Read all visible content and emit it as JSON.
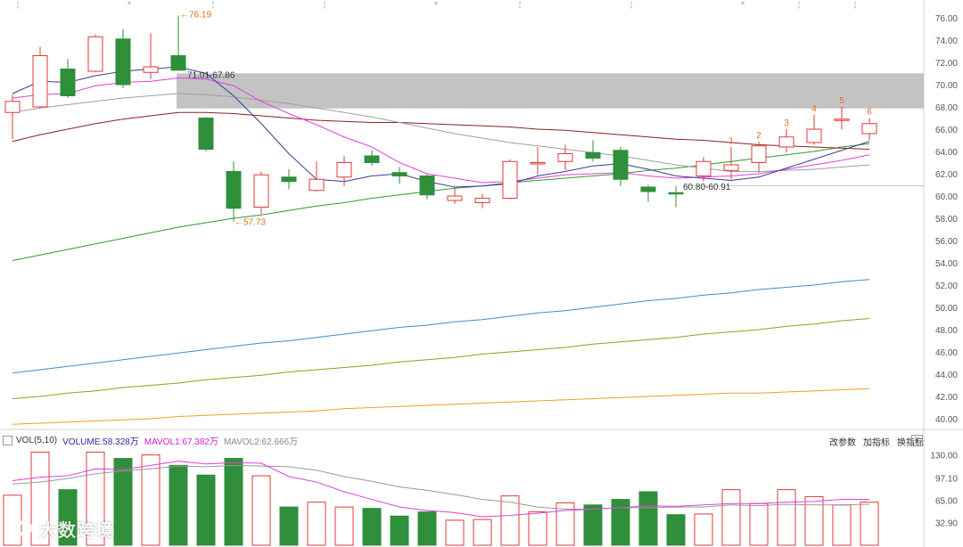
{
  "colors": {
    "up": "#e03a3a",
    "down": "#2f8f3a",
    "ma5": "#3b3b8f",
    "ma10": "#e040e0",
    "ma20": "#a0a0a0",
    "ma60": "#8b2020",
    "ma120": "#2e9c2e",
    "ma250a": "#3a8fd0",
    "ma250b": "#9a9a20",
    "ma250c": "#f0a020",
    "zone": "#b8b8b8",
    "annot": "#e07020",
    "dark_text": "#333333"
  },
  "chart_data": [
    {
      "type": "candlestick",
      "y_ticks": [
        "76.00",
        "74.00",
        "72.00",
        "70.00",
        "68.00",
        "66.00",
        "64.00",
        "62.00",
        "60.00",
        "58.00",
        "56.00",
        "54.00",
        "52.00",
        "50.00",
        "48.00",
        "46.00",
        "44.00",
        "42.00",
        "40.00"
      ],
      "ylim": [
        39.5,
        76.5
      ],
      "candles": [
        {
          "o": 67.5,
          "h": 69.1,
          "l": 65.1,
          "c": 68.5
        },
        {
          "o": 68.0,
          "h": 73.4,
          "l": 67.9,
          "c": 72.6
        },
        {
          "o": 71.4,
          "h": 72.3,
          "l": 68.8,
          "c": 69.0
        },
        {
          "o": 71.2,
          "h": 74.5,
          "l": 71.1,
          "c": 74.3
        },
        {
          "o": 74.1,
          "h": 75.0,
          "l": 69.7,
          "c": 70.0
        },
        {
          "o": 71.1,
          "h": 74.6,
          "l": 70.5,
          "c": 71.6
        },
        {
          "o": 72.6,
          "h": 76.2,
          "l": 71.3,
          "c": 71.3
        },
        {
          "o": 67.0,
          "h": 67.1,
          "l": 64.0,
          "c": 64.2
        },
        {
          "o": 62.2,
          "h": 63.1,
          "l": 57.7,
          "c": 58.9
        },
        {
          "o": 59.0,
          "h": 62.2,
          "l": 58.4,
          "c": 61.9
        },
        {
          "o": 61.7,
          "h": 62.4,
          "l": 60.6,
          "c": 61.3
        },
        {
          "o": 60.5,
          "h": 63.1,
          "l": 60.4,
          "c": 61.5
        },
        {
          "o": 61.7,
          "h": 63.6,
          "l": 60.9,
          "c": 63.0
        },
        {
          "o": 63.6,
          "h": 64.1,
          "l": 62.7,
          "c": 63.0
        },
        {
          "o": 62.1,
          "h": 62.6,
          "l": 61.1,
          "c": 61.8
        },
        {
          "o": 61.8,
          "h": 62.0,
          "l": 59.7,
          "c": 60.1
        },
        {
          "o": 59.6,
          "h": 60.7,
          "l": 59.3,
          "c": 60.0
        },
        {
          "o": 59.4,
          "h": 60.2,
          "l": 58.9,
          "c": 59.8
        },
        {
          "o": 59.8,
          "h": 63.3,
          "l": 59.7,
          "c": 63.1
        },
        {
          "o": 63.0,
          "h": 64.4,
          "l": 61.9,
          "c": 63.0
        },
        {
          "o": 63.1,
          "h": 64.6,
          "l": 62.3,
          "c": 63.8
        },
        {
          "o": 63.9,
          "h": 65.0,
          "l": 63.1,
          "c": 63.4
        },
        {
          "o": 64.1,
          "h": 64.4,
          "l": 60.9,
          "c": 61.5
        },
        {
          "o": 60.8,
          "h": 61.0,
          "l": 59.5,
          "c": 60.4
        },
        {
          "o": 60.3,
          "h": 60.9,
          "l": 59.0,
          "c": 60.2
        },
        {
          "o": 61.8,
          "h": 63.5,
          "l": 61.3,
          "c": 63.1
        },
        {
          "o": 62.3,
          "h": 64.4,
          "l": 61.5,
          "c": 62.8
        },
        {
          "o": 63.0,
          "h": 64.9,
          "l": 62.1,
          "c": 64.5
        },
        {
          "o": 64.4,
          "h": 66.0,
          "l": 63.9,
          "c": 65.3
        },
        {
          "o": 64.8,
          "h": 67.3,
          "l": 64.6,
          "c": 66.0
        },
        {
          "o": 66.9,
          "h": 68.0,
          "l": 66.0,
          "c": 66.9
        },
        {
          "o": 65.6,
          "h": 67.0,
          "l": 65.0,
          "c": 66.5
        }
      ],
      "ma5": [
        69.2,
        70.3,
        70.2,
        70.8,
        71.2,
        71.4,
        71.6,
        71.0,
        69.0,
        66.5,
        63.8,
        61.5,
        61.3,
        61.8,
        62.0,
        61.3,
        60.8,
        60.9,
        61.1,
        61.8,
        62.2,
        62.7,
        62.9,
        62.4,
        61.8,
        61.6,
        61.4,
        61.7,
        62.5,
        63.3,
        64.1,
        64.9
      ],
      "ma10": [
        68.8,
        69.1,
        69.2,
        69.9,
        70.2,
        70.3,
        70.6,
        70.5,
        69.9,
        68.5,
        67.4,
        66.4,
        65.3,
        64.4,
        63.0,
        62.0,
        61.6,
        61.2,
        61.3,
        61.6,
        61.9,
        62.0,
        62.1,
        61.8,
        61.6,
        61.7,
        61.8,
        62.0,
        62.4,
        62.8,
        63.2,
        63.7
      ],
      "ma20": [
        67.5,
        67.9,
        68.2,
        68.5,
        68.8,
        69.0,
        69.2,
        69.1,
        68.9,
        68.6,
        68.3,
        67.9,
        67.5,
        67.1,
        66.6,
        66.1,
        65.6,
        65.2,
        64.8,
        64.5,
        64.2,
        63.9,
        63.6,
        63.2,
        62.8,
        62.5,
        62.2,
        62.2,
        62.3,
        62.4,
        62.6,
        62.8
      ],
      "ma60": [
        64.9,
        65.5,
        66.0,
        66.5,
        66.9,
        67.2,
        67.5,
        67.5,
        67.4,
        67.2,
        67.0,
        66.8,
        66.7,
        66.6,
        66.6,
        66.5,
        66.4,
        66.3,
        66.2,
        66.0,
        65.9,
        65.7,
        65.5,
        65.3,
        65.1,
        65.0,
        64.8,
        64.6,
        64.5,
        64.4,
        64.3,
        64.2
      ],
      "ma120": [
        54.2,
        54.7,
        55.2,
        55.7,
        56.2,
        56.7,
        57.2,
        57.6,
        58.0,
        58.3,
        58.7,
        59.1,
        59.4,
        59.8,
        60.1,
        60.4,
        60.7,
        60.9,
        61.2,
        61.4,
        61.6,
        61.8,
        62.0,
        62.3,
        62.5,
        62.8,
        63.1,
        63.4,
        63.7,
        64.0,
        64.4,
        64.7
      ],
      "ma250a": [
        44.1,
        44.4,
        44.7,
        45.0,
        45.3,
        45.6,
        45.9,
        46.2,
        46.5,
        46.8,
        47.0,
        47.3,
        47.6,
        47.9,
        48.2,
        48.4,
        48.7,
        48.9,
        49.2,
        49.5,
        49.7,
        50.0,
        50.3,
        50.6,
        50.8,
        51.1,
        51.3,
        51.6,
        51.8,
        52.0,
        52.3,
        52.5
      ],
      "ma250b": [
        41.8,
        42.0,
        42.3,
        42.5,
        42.8,
        43.0,
        43.2,
        43.5,
        43.7,
        43.9,
        44.2,
        44.4,
        44.6,
        44.8,
        45.1,
        45.3,
        45.5,
        45.8,
        46.0,
        46.2,
        46.4,
        46.7,
        46.9,
        47.1,
        47.3,
        47.6,
        47.8,
        48.0,
        48.3,
        48.5,
        48.8,
        49.0
      ],
      "ma250c": [
        39.5,
        39.6,
        39.7,
        39.8,
        39.9,
        40.0,
        40.2,
        40.3,
        40.4,
        40.5,
        40.6,
        40.7,
        40.9,
        41.0,
        41.1,
        41.2,
        41.3,
        41.4,
        41.5,
        41.6,
        41.7,
        41.8,
        41.9,
        42.0,
        42.1,
        42.2,
        42.3,
        42.3,
        42.4,
        42.5,
        42.6,
        42.7
      ],
      "annotations": {
        "high": "76.19",
        "low": "57.73",
        "gap_upper": "71.01-67.86",
        "gap_lower": "60.80-60.91"
      },
      "gap_zone": [
        67.86,
        71.01
      ],
      "support_line": 60.91,
      "numbered_labels": [
        "1",
        "2",
        "3",
        "4",
        "5",
        "6"
      ]
    },
    {
      "type": "bar",
      "name": "volume",
      "y_ticks": [
        "130.00",
        "97.10",
        "65.00",
        "32.90"
      ],
      "ylim": [
        0,
        136
      ],
      "values": [
        72,
        134,
        80,
        134,
        125,
        130,
        115,
        101,
        125,
        100,
        55,
        62,
        55,
        53,
        42,
        48,
        36,
        37,
        71,
        48,
        61,
        58,
        66,
        77,
        44,
        45,
        80,
        60,
        80,
        70,
        58,
        62
      ],
      "mavol1": [
        93,
        98,
        100,
        110,
        109,
        115,
        121,
        117,
        119,
        118,
        99,
        91,
        77,
        66,
        55,
        50,
        47,
        41,
        43,
        46,
        50,
        52,
        54,
        57,
        56,
        58,
        60,
        60,
        62,
        63,
        66,
        66
      ],
      "mavol2": [
        88,
        91,
        96,
        103,
        107,
        110,
        114,
        113,
        115,
        114,
        113,
        108,
        99,
        92,
        84,
        79,
        73,
        66,
        62,
        55,
        52,
        52,
        54,
        54,
        55,
        55,
        58,
        57,
        59,
        58,
        58,
        59
      ]
    }
  ],
  "volume_legend": {
    "indicator": "VOL(5,10)",
    "volume": "VOLUME:58.328万",
    "mavol1": "MAVOL1:67.382万",
    "mavol2": "MAVOL2:62.666万"
  },
  "toolbar": {
    "params": "改参数",
    "add": "加指标",
    "switch": "换指标",
    "close_glyph": "×"
  },
  "watermark": {
    "text": "大数跨境"
  }
}
